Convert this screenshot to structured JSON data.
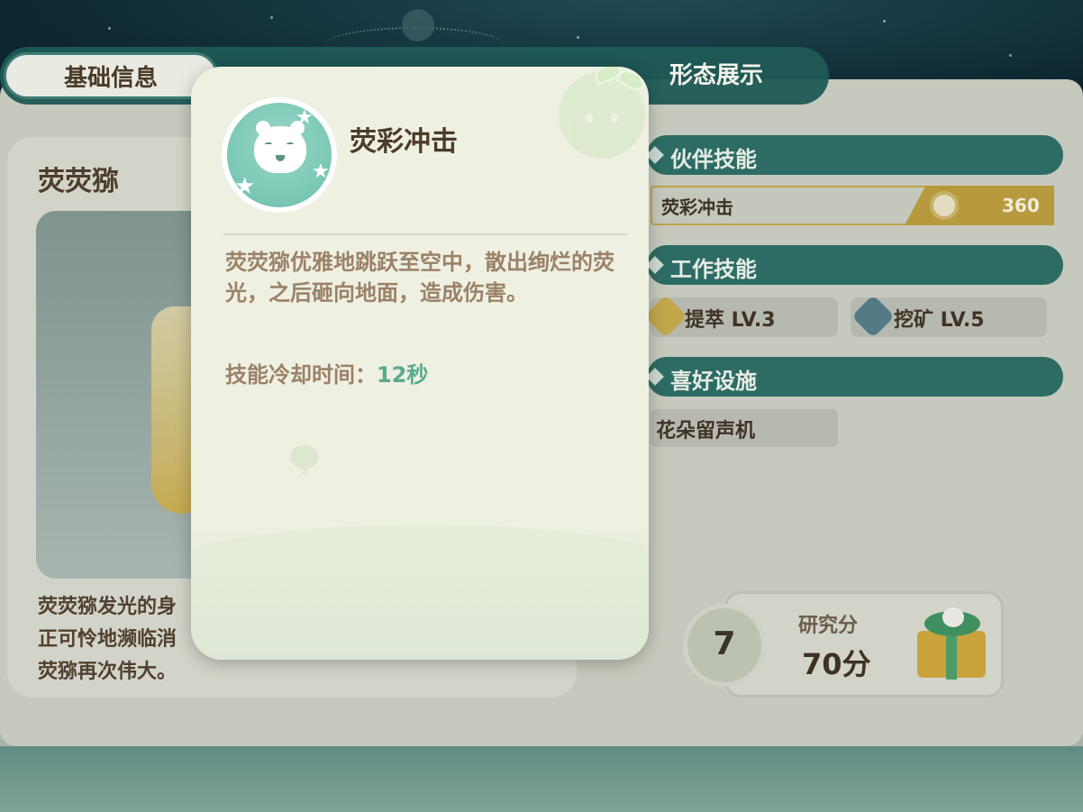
{
  "tabs": [
    {
      "label": "基础信息"
    },
    {
      "label": ""
    },
    {
      "label": ""
    },
    {
      "label": "形态展示"
    }
  ],
  "pal": {
    "name": "荧荧猕",
    "description_lines": [
      "荧荧猕发光的身",
      "正可怜地濒临消",
      "荧猕再次伟大。"
    ]
  },
  "partner_skill_section": {
    "title": "伙伴技能"
  },
  "partner_skill": {
    "name": "荧彩冲击",
    "value": "360",
    "icon": "ring-icon"
  },
  "work_skill_section": {
    "title": "工作技能"
  },
  "work_skills": [
    {
      "label": "提萃 LV.3",
      "icon": "extract-icon"
    },
    {
      "label": "挖矿 LV.5",
      "icon": "pickaxe-icon"
    }
  ],
  "favorite_section": {
    "title": "喜好设施"
  },
  "favorite_facility": {
    "label": "花朵留声机"
  },
  "research": {
    "level": "7",
    "title": "研究分",
    "points": "70分",
    "icon": "gift-icon"
  },
  "popup": {
    "title": "荧彩冲击",
    "icon": "bear-face-icon",
    "description": "荧荧猕优雅地跳跃至空中，散出绚烂的荧光，之后砸向地面，造成伤害。",
    "cooldown_label": "技能冷却时间：",
    "cooldown_value": "12秒"
  },
  "colors": {
    "accent_teal": "#2d6c64",
    "gold": "#b69a3d",
    "cooldown_green": "#5aaa8c",
    "popup_bg": "#eef0e2"
  }
}
